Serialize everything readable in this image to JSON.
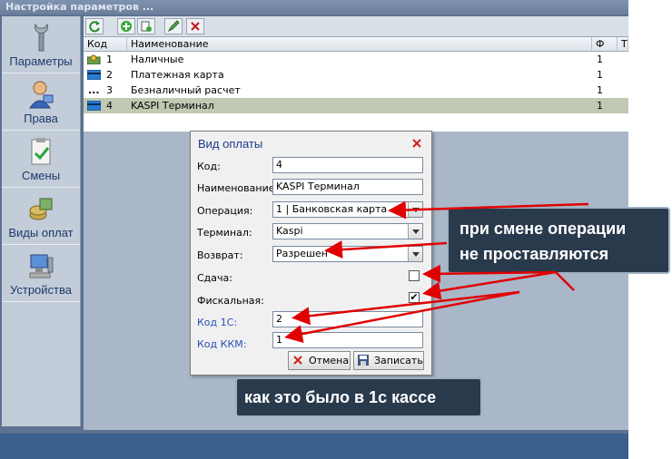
{
  "window": {
    "title": "Настройка параметров ..."
  },
  "sidebar": {
    "items": [
      {
        "label": "Параметры",
        "icon": "wrench-icon"
      },
      {
        "label": "Права",
        "icon": "user-icon"
      },
      {
        "label": "Смены",
        "icon": "clipboard-check-icon"
      },
      {
        "label": "Виды оплат",
        "icon": "coins-icon"
      },
      {
        "label": "Устройства",
        "icon": "computer-icon"
      }
    ]
  },
  "toolbar": {
    "buttons": [
      "refresh-icon",
      "add-icon",
      "copy-icon",
      "edit-icon",
      "delete-icon"
    ]
  },
  "grid": {
    "columns": [
      "Код",
      "Наименование",
      "Ф",
      "Т"
    ],
    "rows": [
      {
        "code": "1",
        "name": "Наличные",
        "f": "1",
        "icon": "cash-icon"
      },
      {
        "code": "2",
        "name": "Платежная карта",
        "f": "1",
        "icon": "card-icon"
      },
      {
        "code": "3",
        "name": "Безналичный расчет",
        "f": "1",
        "icon": "dots-icon"
      },
      {
        "code": "4",
        "name": "KASPI  Терминал",
        "f": "1",
        "icon": "card-icon"
      }
    ]
  },
  "dialog": {
    "title": "Вид оплаты",
    "fields": {
      "code_label": "Код:",
      "code_value": "4",
      "name_label": "Наименование:",
      "name_value": "KASPI  Терминал",
      "operation_label": "Операция:",
      "operation_value": "1 | Банковская карта",
      "terminal_label": "Терминал:",
      "terminal_value": "Kaspi",
      "return_label": "Возврат:",
      "return_value": "Разрешен",
      "change_label": "Сдача:",
      "change_checked": false,
      "fiscal_label": "Фискальная:",
      "fiscal_checked": true,
      "code1c_label": "Код 1С:",
      "code1c_value": "2",
      "codekkm_label": "Код ККМ:",
      "codekkm_value": "1"
    },
    "cancel_label": "Отмена",
    "save_label": "Записать",
    "check_mark": "✔"
  },
  "callouts": {
    "top_line1": "при смене операции",
    "top_line2": "не проставляются",
    "bottom": "как это было в 1с кассе"
  },
  "colors": {
    "arrow": "#e00000",
    "callout_bg": "#2a3a4d",
    "selected_row": "#c2c9b3"
  }
}
